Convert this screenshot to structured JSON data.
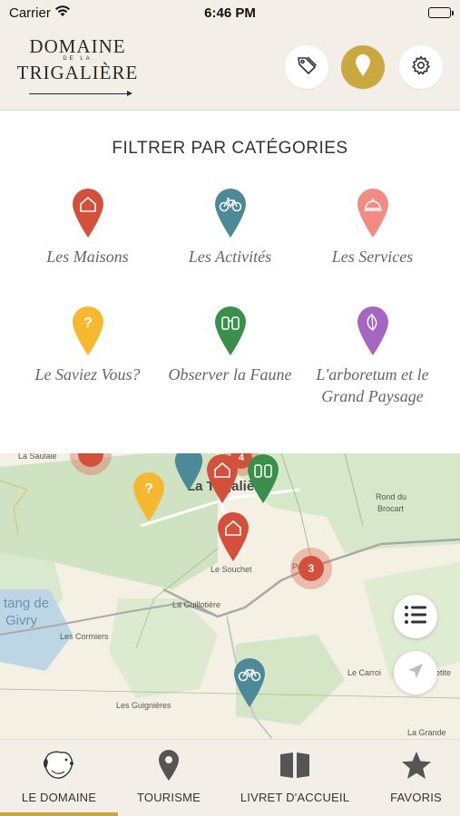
{
  "status_bar": {
    "carrier": "Carrier",
    "time": "6:46 PM"
  },
  "header": {
    "logo": {
      "line1": "DOMAINE",
      "line2": "DE LA",
      "line3": "TRIGALIÈRE"
    },
    "accent_color": "#c9a93d"
  },
  "filter": {
    "title": "FILTRER PAR CATÉGORIES",
    "categories": [
      {
        "label": "Les Maisons",
        "color": "#d5503b",
        "icon": "house-icon"
      },
      {
        "label": "Les Activités",
        "color": "#4b8a96",
        "icon": "bicycle-icon"
      },
      {
        "label": "Les Services",
        "color": "#f28b82",
        "icon": "cloche-icon"
      },
      {
        "label": "Le Saviez Vous?",
        "color": "#f5b82e",
        "icon": "question-icon"
      },
      {
        "label": "Observer la Faune",
        "color": "#3a8f4a",
        "icon": "binoculars-icon"
      },
      {
        "label": "L'arboretum et le Grand Paysage",
        "color": "#a466c0",
        "icon": "leaf-icon"
      }
    ]
  },
  "map": {
    "places": {
      "main": "La Trigalière",
      "rond": "Rond du",
      "rond2": "Brocart",
      "souchet": "Le Souchet",
      "guillotiere": "La Guillotière",
      "cormiers": "Les Cormiers",
      "guignieres": "Les Guignières",
      "carroi": "Le Carroi",
      "grande": "La Grande",
      "presson": "Présson",
      "etang1": "tang de",
      "etang2": "Givry",
      "saulaie": "La Saulaie",
      "petite": "etite"
    },
    "clusters": [
      {
        "count": "3"
      },
      {
        "count": "4"
      }
    ]
  },
  "tabbar": {
    "tabs": [
      {
        "label": "LE DOMAINE",
        "icon": "dog-icon",
        "active": true
      },
      {
        "label": "TOURISME",
        "icon": "map-pin-icon",
        "active": false
      },
      {
        "label": "LIVRET D'ACCUEIL",
        "icon": "book-icon",
        "active": false
      },
      {
        "label": "FAVORIS",
        "icon": "star-icon",
        "active": false
      }
    ]
  }
}
